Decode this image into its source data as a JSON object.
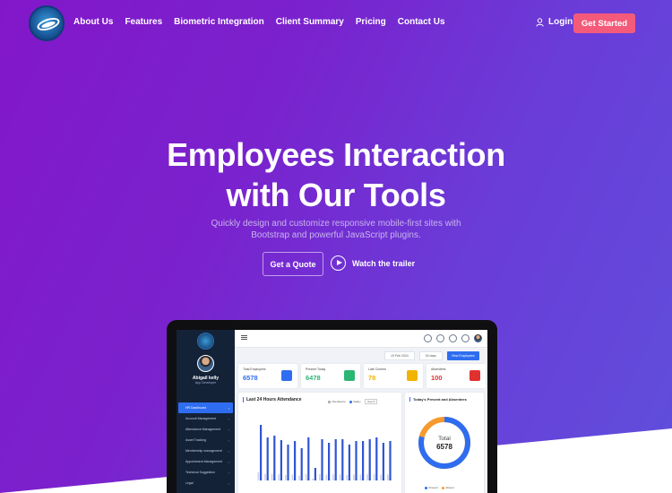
{
  "brand": {
    "logo": "swoosh-globe-logo"
  },
  "nav": {
    "items": [
      "About Us",
      "Features",
      "Biometric Integration",
      "Client Summary",
      "Pricing",
      "Contact Us"
    ],
    "login_label": "Login",
    "get_started_label": "Get Started"
  },
  "hero": {
    "title_line1": "Employees Interaction",
    "title_line2": "with Our Tools",
    "subtitle_line1": "Quickly design and customize responsive mobile-first sites with",
    "subtitle_line2": "Bootstrap and powerful JavaScript plugins.",
    "quote_label": "Get a Quote",
    "trailer_label": "Watch the trailer"
  },
  "dashboard": {
    "user_name": "Abigail kelly",
    "user_role": "App Developer",
    "sidebar_items": [
      "HR Dashboard",
      "Account Management",
      "Attendance Management",
      "Asset Tracking",
      "Membership management",
      "Appointment Management",
      "Technical Suggestion",
      "Legal"
    ],
    "date_chip": "19 Feb 2024",
    "days_chip": "30 days",
    "view_button": "View Employees",
    "cards": [
      {
        "label": "Total Employees",
        "value": "6578",
        "color": "#2f6df0"
      },
      {
        "label": "Present Today",
        "value": "6478",
        "color": "#2bb673"
      },
      {
        "label": "Late Comers",
        "value": "78",
        "color": "#f0b400"
      },
      {
        "label": "Absentees",
        "value": "100",
        "color": "#e0312f"
      }
    ],
    "attendance_title": "Last 24 Hours Attendance",
    "attendance_legend": [
      "Attendance",
      "Salary"
    ],
    "attendance_filter": "Year",
    "donut_title": "Today's Present and Absentees",
    "donut_center_label": "Total",
    "donut_center_value": "6578",
    "donut_legend": [
      "Present",
      "Absent"
    ]
  },
  "colors": {
    "accent_button": "#f45a79",
    "primary": "#2f6df0",
    "present": "#2f6df0",
    "absent": "#f59a2c"
  }
}
